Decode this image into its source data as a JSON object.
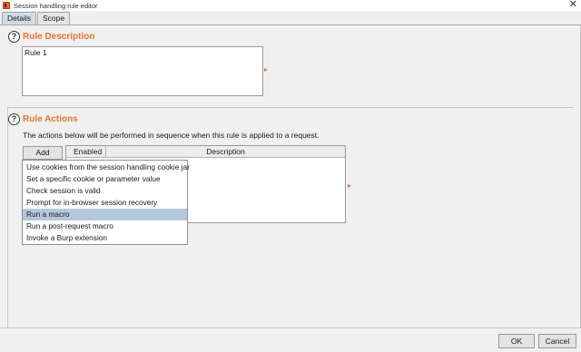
{
  "window": {
    "title": "Session handling rule editor",
    "close_glyph": "✕"
  },
  "tabs": [
    {
      "label": "Details",
      "active": true
    },
    {
      "label": "Scope",
      "active": false
    }
  ],
  "rule_description": {
    "title": "Rule Description",
    "help_glyph": "?",
    "value": "Rule 1"
  },
  "rule_actions": {
    "title": "Rule Actions",
    "help_glyph": "?",
    "description": "The actions below will be performed in sequence when this rule is applied to a request.",
    "add_label": "Add",
    "columns": [
      "Enabled",
      "Description"
    ],
    "menu_items": [
      "Use cookies from the session handling cookie jar",
      "Set a specific cookie or parameter value",
      "Check session is valid",
      "Prompt for in-browser session recovery",
      "Run a macro",
      "Run a post-request macro",
      "Invoke a Burp extension"
    ],
    "selected_item": "Run a macro"
  },
  "footer": {
    "ok_label": "OK",
    "cancel_label": "Cancel"
  },
  "colors": {
    "accent": "#e8742f",
    "selection": "#b5c7dc",
    "active_tab": "#cfdcea"
  }
}
